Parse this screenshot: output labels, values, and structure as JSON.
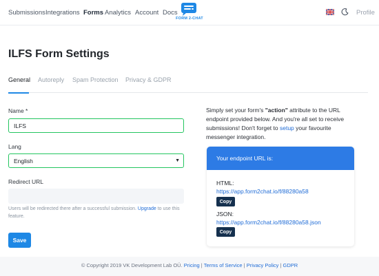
{
  "nav": {
    "links": [
      "Submissions",
      "Integrations",
      "Forms",
      "Analytics",
      "Account",
      "Docs"
    ],
    "active": "Forms",
    "logo_text": "FORM 2-CHAT",
    "language_icon": "uk-flag-icon",
    "theme_icon": "moon-icon",
    "profile": "Profile"
  },
  "page": {
    "title": "ILFS Form Settings",
    "tabs": [
      "General",
      "Autoreply",
      "Spam Protection",
      "Privacy & GDPR"
    ],
    "active_tab": "General"
  },
  "form": {
    "name_label": "Name *",
    "name_value": "ILFS",
    "lang_label": "Lang",
    "lang_value": "English",
    "redirect_label": "Redirect URL",
    "redirect_value": "",
    "hint_text": "Users will be redirected there after a successful submission.",
    "hint_link": "Upgrade",
    "hint_after": " to use this feature.",
    "save_label": "Save"
  },
  "intro": {
    "t1": "Simply set your form's ",
    "t2": "\"action\"",
    "t3": " attribute to the URL endpoint provided below. And you're all set to receive submissions! Don't forget to ",
    "link": "setup",
    "t4": " your favourite messenger integration."
  },
  "endpoint": {
    "header": "Your endpoint URL is:",
    "html_label": "HTML:",
    "html_url": "https://app.form2chat.io/f/88280a58",
    "json_label": "JSON:",
    "json_url": "https://app.form2chat.io/f/88280a58.json",
    "copy_label": "Copy"
  },
  "footer": {
    "copyright": "© Copyright 2019 VK Development Lab OÜ.",
    "links": [
      "Pricing",
      "Terms of Service",
      "Privacy Policy",
      "GDPR"
    ],
    "separator": " | "
  },
  "colors": {
    "accent": "#1e88e5",
    "valid_border": "#22c55e",
    "copy_button": "#15304e",
    "endpoint_header": "#2d7be5"
  }
}
